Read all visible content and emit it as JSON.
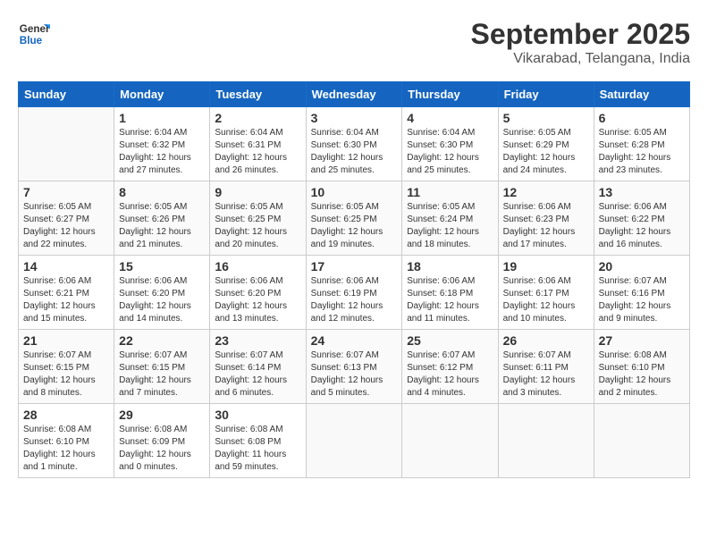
{
  "header": {
    "logo_general": "General",
    "logo_blue": "Blue",
    "month": "September 2025",
    "location": "Vikarabad, Telangana, India"
  },
  "columns": [
    "Sunday",
    "Monday",
    "Tuesday",
    "Wednesday",
    "Thursday",
    "Friday",
    "Saturday"
  ],
  "weeks": [
    [
      {
        "day": "",
        "sunrise": "",
        "sunset": "",
        "daylight": ""
      },
      {
        "day": "1",
        "sunrise": "Sunrise: 6:04 AM",
        "sunset": "Sunset: 6:32 PM",
        "daylight": "Daylight: 12 hours and 27 minutes."
      },
      {
        "day": "2",
        "sunrise": "Sunrise: 6:04 AM",
        "sunset": "Sunset: 6:31 PM",
        "daylight": "Daylight: 12 hours and 26 minutes."
      },
      {
        "day": "3",
        "sunrise": "Sunrise: 6:04 AM",
        "sunset": "Sunset: 6:30 PM",
        "daylight": "Daylight: 12 hours and 25 minutes."
      },
      {
        "day": "4",
        "sunrise": "Sunrise: 6:04 AM",
        "sunset": "Sunset: 6:30 PM",
        "daylight": "Daylight: 12 hours and 25 minutes."
      },
      {
        "day": "5",
        "sunrise": "Sunrise: 6:05 AM",
        "sunset": "Sunset: 6:29 PM",
        "daylight": "Daylight: 12 hours and 24 minutes."
      },
      {
        "day": "6",
        "sunrise": "Sunrise: 6:05 AM",
        "sunset": "Sunset: 6:28 PM",
        "daylight": "Daylight: 12 hours and 23 minutes."
      }
    ],
    [
      {
        "day": "7",
        "sunrise": "Sunrise: 6:05 AM",
        "sunset": "Sunset: 6:27 PM",
        "daylight": "Daylight: 12 hours and 22 minutes."
      },
      {
        "day": "8",
        "sunrise": "Sunrise: 6:05 AM",
        "sunset": "Sunset: 6:26 PM",
        "daylight": "Daylight: 12 hours and 21 minutes."
      },
      {
        "day": "9",
        "sunrise": "Sunrise: 6:05 AM",
        "sunset": "Sunset: 6:25 PM",
        "daylight": "Daylight: 12 hours and 20 minutes."
      },
      {
        "day": "10",
        "sunrise": "Sunrise: 6:05 AM",
        "sunset": "Sunset: 6:25 PM",
        "daylight": "Daylight: 12 hours and 19 minutes."
      },
      {
        "day": "11",
        "sunrise": "Sunrise: 6:05 AM",
        "sunset": "Sunset: 6:24 PM",
        "daylight": "Daylight: 12 hours and 18 minutes."
      },
      {
        "day": "12",
        "sunrise": "Sunrise: 6:06 AM",
        "sunset": "Sunset: 6:23 PM",
        "daylight": "Daylight: 12 hours and 17 minutes."
      },
      {
        "day": "13",
        "sunrise": "Sunrise: 6:06 AM",
        "sunset": "Sunset: 6:22 PM",
        "daylight": "Daylight: 12 hours and 16 minutes."
      }
    ],
    [
      {
        "day": "14",
        "sunrise": "Sunrise: 6:06 AM",
        "sunset": "Sunset: 6:21 PM",
        "daylight": "Daylight: 12 hours and 15 minutes."
      },
      {
        "day": "15",
        "sunrise": "Sunrise: 6:06 AM",
        "sunset": "Sunset: 6:20 PM",
        "daylight": "Daylight: 12 hours and 14 minutes."
      },
      {
        "day": "16",
        "sunrise": "Sunrise: 6:06 AM",
        "sunset": "Sunset: 6:20 PM",
        "daylight": "Daylight: 12 hours and 13 minutes."
      },
      {
        "day": "17",
        "sunrise": "Sunrise: 6:06 AM",
        "sunset": "Sunset: 6:19 PM",
        "daylight": "Daylight: 12 hours and 12 minutes."
      },
      {
        "day": "18",
        "sunrise": "Sunrise: 6:06 AM",
        "sunset": "Sunset: 6:18 PM",
        "daylight": "Daylight: 12 hours and 11 minutes."
      },
      {
        "day": "19",
        "sunrise": "Sunrise: 6:06 AM",
        "sunset": "Sunset: 6:17 PM",
        "daylight": "Daylight: 12 hours and 10 minutes."
      },
      {
        "day": "20",
        "sunrise": "Sunrise: 6:07 AM",
        "sunset": "Sunset: 6:16 PM",
        "daylight": "Daylight: 12 hours and 9 minutes."
      }
    ],
    [
      {
        "day": "21",
        "sunrise": "Sunrise: 6:07 AM",
        "sunset": "Sunset: 6:15 PM",
        "daylight": "Daylight: 12 hours and 8 minutes."
      },
      {
        "day": "22",
        "sunrise": "Sunrise: 6:07 AM",
        "sunset": "Sunset: 6:15 PM",
        "daylight": "Daylight: 12 hours and 7 minutes."
      },
      {
        "day": "23",
        "sunrise": "Sunrise: 6:07 AM",
        "sunset": "Sunset: 6:14 PM",
        "daylight": "Daylight: 12 hours and 6 minutes."
      },
      {
        "day": "24",
        "sunrise": "Sunrise: 6:07 AM",
        "sunset": "Sunset: 6:13 PM",
        "daylight": "Daylight: 12 hours and 5 minutes."
      },
      {
        "day": "25",
        "sunrise": "Sunrise: 6:07 AM",
        "sunset": "Sunset: 6:12 PM",
        "daylight": "Daylight: 12 hours and 4 minutes."
      },
      {
        "day": "26",
        "sunrise": "Sunrise: 6:07 AM",
        "sunset": "Sunset: 6:11 PM",
        "daylight": "Daylight: 12 hours and 3 minutes."
      },
      {
        "day": "27",
        "sunrise": "Sunrise: 6:08 AM",
        "sunset": "Sunset: 6:10 PM",
        "daylight": "Daylight: 12 hours and 2 minutes."
      }
    ],
    [
      {
        "day": "28",
        "sunrise": "Sunrise: 6:08 AM",
        "sunset": "Sunset: 6:10 PM",
        "daylight": "Daylight: 12 hours and 1 minute."
      },
      {
        "day": "29",
        "sunrise": "Sunrise: 6:08 AM",
        "sunset": "Sunset: 6:09 PM",
        "daylight": "Daylight: 12 hours and 0 minutes."
      },
      {
        "day": "30",
        "sunrise": "Sunrise: 6:08 AM",
        "sunset": "Sunset: 6:08 PM",
        "daylight": "Daylight: 11 hours and 59 minutes."
      },
      {
        "day": "",
        "sunrise": "",
        "sunset": "",
        "daylight": ""
      },
      {
        "day": "",
        "sunrise": "",
        "sunset": "",
        "daylight": ""
      },
      {
        "day": "",
        "sunrise": "",
        "sunset": "",
        "daylight": ""
      },
      {
        "day": "",
        "sunrise": "",
        "sunset": "",
        "daylight": ""
      }
    ]
  ]
}
